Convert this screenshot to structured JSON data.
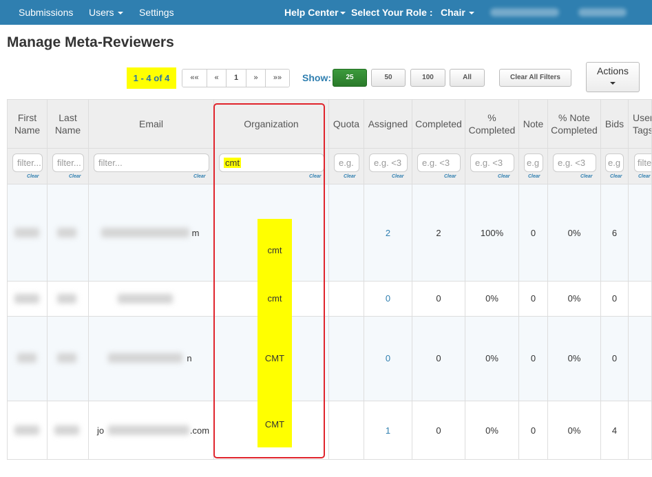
{
  "nav": {
    "submissions": "Submissions",
    "users": "Users",
    "settings": "Settings",
    "help_center": "Help Center",
    "select_role": "Select Your Role :",
    "role": "Chair"
  },
  "page_title": "Manage Meta-Reviewers",
  "pager": {
    "count": "1 - 4 of 4",
    "first": "««",
    "prev": "«",
    "page": "1",
    "next": "»",
    "last": "»»",
    "show_label": "Show:",
    "sizes": [
      "25",
      "50",
      "100",
      "All"
    ],
    "clear_all": "Clear All Filters",
    "actions": "Actions"
  },
  "table": {
    "headers": {
      "first_name": [
        "First",
        "Name"
      ],
      "last_name": [
        "Last",
        "Name"
      ],
      "email": "Email",
      "organization": "Organization",
      "quota": "Quota",
      "assigned": "Assigned",
      "completed": "Completed",
      "pct_completed": [
        "%",
        "Completed"
      ],
      "note": "Note",
      "pct_note": [
        "% Note",
        "Completed"
      ],
      "bids": "Bids",
      "user_tags": [
        "User",
        "Tags"
      ]
    },
    "filters": {
      "first_name": "filter...",
      "last_name": "filter...",
      "email": "filter...",
      "organization": "cmt",
      "quota": "e.g.",
      "assigned": "e.g. <3",
      "completed": "e.g. <3",
      "pct_completed": "e.g. <3",
      "note": "e.g",
      "pct_note": "e.g. <3",
      "bids": "e.g",
      "user_tags": "filte"
    },
    "clear_label": "Clear",
    "rows": [
      {
        "email_suffix": "m",
        "org": "cmt",
        "assigned": "2",
        "completed": "2",
        "pct": "100%",
        "note": "0",
        "pct_note": "0%",
        "bids": "6"
      },
      {
        "email_suffix": "",
        "org": "cmt",
        "assigned": "0",
        "completed": "0",
        "pct": "0%",
        "note": "0",
        "pct_note": "0%",
        "bids": "0"
      },
      {
        "email_suffix": "n",
        "org": "CMT",
        "assigned": "0",
        "completed": "0",
        "pct": "0%",
        "note": "0",
        "pct_note": "0%",
        "bids": "0"
      },
      {
        "email_prefix": "jo",
        "email_suffix": ".com",
        "org": "CMT",
        "assigned": "1",
        "completed": "0",
        "pct": "0%",
        "note": "0",
        "pct_note": "0%",
        "bids": "4"
      }
    ]
  }
}
